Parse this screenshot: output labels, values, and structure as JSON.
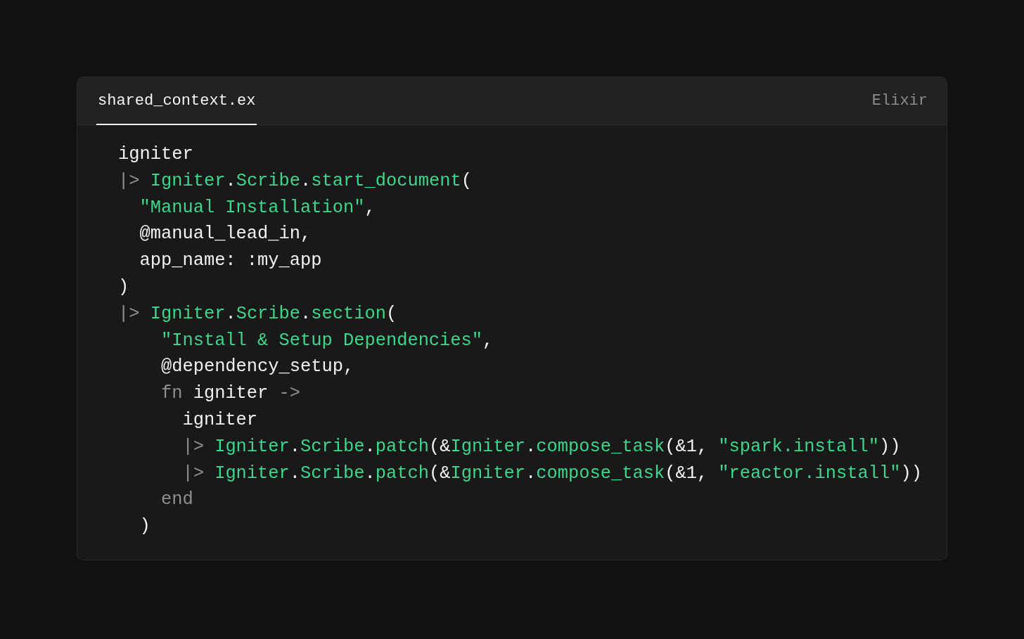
{
  "file_tab": {
    "label": "shared_context.ex",
    "selected": true
  },
  "language": "Elixir",
  "code_lines": [
    {
      "tokens": [
        {
          "kind": "plain",
          "text": "igniter"
        }
      ]
    },
    {
      "tokens": [
        {
          "kind": "op",
          "text": "|> "
        },
        {
          "kind": "fn",
          "text": "Igniter"
        },
        {
          "kind": "plain",
          "text": "."
        },
        {
          "kind": "fn",
          "text": "Scribe"
        },
        {
          "kind": "plain",
          "text": "."
        },
        {
          "kind": "fn",
          "text": "start_document"
        },
        {
          "kind": "plain",
          "text": "("
        }
      ]
    },
    {
      "tokens": [
        {
          "kind": "string",
          "text": "  \"Manual Installation\""
        },
        {
          "kind": "plain",
          "text": ","
        }
      ]
    },
    {
      "tokens": [
        {
          "kind": "plain",
          "text": "  @manual_lead_in,"
        }
      ]
    },
    {
      "tokens": [
        {
          "kind": "plain",
          "text": "  app_name: :my_app"
        }
      ]
    },
    {
      "tokens": [
        {
          "kind": "plain",
          "text": ")"
        }
      ]
    },
    {
      "tokens": [
        {
          "kind": "op",
          "text": "|> "
        },
        {
          "kind": "fn",
          "text": "Igniter"
        },
        {
          "kind": "plain",
          "text": "."
        },
        {
          "kind": "fn",
          "text": "Scribe"
        },
        {
          "kind": "plain",
          "text": "."
        },
        {
          "kind": "fn",
          "text": "section"
        },
        {
          "kind": "plain",
          "text": "("
        }
      ]
    },
    {
      "tokens": [
        {
          "kind": "string",
          "text": "    \"Install & Setup Dependencies\""
        },
        {
          "kind": "plain",
          "text": ","
        }
      ]
    },
    {
      "tokens": [
        {
          "kind": "plain",
          "text": "    @dependency_setup,"
        }
      ]
    },
    {
      "tokens": [
        {
          "kind": "op",
          "text": "    fn "
        },
        {
          "kind": "plain",
          "text": "igniter "
        },
        {
          "kind": "op",
          "text": "->"
        }
      ]
    },
    {
      "tokens": [
        {
          "kind": "plain",
          "text": "      igniter"
        }
      ]
    },
    {
      "tokens": [
        {
          "kind": "op",
          "text": "      |> "
        },
        {
          "kind": "fn",
          "text": "Igniter"
        },
        {
          "kind": "plain",
          "text": "."
        },
        {
          "kind": "fn",
          "text": "Scribe"
        },
        {
          "kind": "plain",
          "text": "."
        },
        {
          "kind": "fn",
          "text": "patch"
        },
        {
          "kind": "plain",
          "text": "(&"
        },
        {
          "kind": "fn",
          "text": "Igniter"
        },
        {
          "kind": "plain",
          "text": "."
        },
        {
          "kind": "fn",
          "text": "compose_task"
        },
        {
          "kind": "plain",
          "text": "(&1, "
        },
        {
          "kind": "string",
          "text": "\"spark.install\""
        },
        {
          "kind": "plain",
          "text": "))"
        }
      ]
    },
    {
      "tokens": [
        {
          "kind": "op",
          "text": "      |> "
        },
        {
          "kind": "fn",
          "text": "Igniter"
        },
        {
          "kind": "plain",
          "text": "."
        },
        {
          "kind": "fn",
          "text": "Scribe"
        },
        {
          "kind": "plain",
          "text": "."
        },
        {
          "kind": "fn",
          "text": "patch"
        },
        {
          "kind": "plain",
          "text": "(&"
        },
        {
          "kind": "fn",
          "text": "Igniter"
        },
        {
          "kind": "plain",
          "text": "."
        },
        {
          "kind": "fn",
          "text": "compose_task"
        },
        {
          "kind": "plain",
          "text": "(&1, "
        },
        {
          "kind": "string",
          "text": "\"reactor.install\""
        },
        {
          "kind": "plain",
          "text": "))"
        }
      ]
    },
    {
      "tokens": [
        {
          "kind": "op",
          "text": "    end"
        }
      ]
    },
    {
      "tokens": [
        {
          "kind": "plain",
          "text": "  )"
        }
      ]
    }
  ]
}
